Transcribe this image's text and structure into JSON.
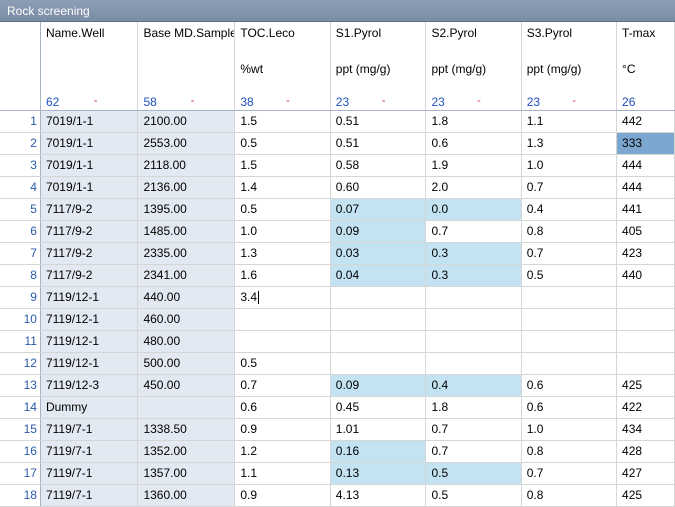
{
  "window": {
    "title": "Rock screening"
  },
  "columns": [
    {
      "name": "Name.Well",
      "unit": "",
      "count": "62",
      "minus": "-"
    },
    {
      "name": "Base MD.Sample",
      "unit": "",
      "count": "58",
      "minus": "-"
    },
    {
      "name": "TOC.Leco",
      "unit": "%wt",
      "count": "38",
      "minus": "-"
    },
    {
      "name": "S1.Pyrol",
      "unit": "ppt (mg/g)",
      "count": "23",
      "minus": "-"
    },
    {
      "name": "S2.Pyrol",
      "unit": "ppt (mg/g)",
      "count": "23",
      "minus": "-"
    },
    {
      "name": "S3.Pyrol",
      "unit": "ppt (mg/g)",
      "count": "23",
      "minus": "-"
    },
    {
      "name": "T-max",
      "unit": "°C",
      "count": "26",
      "minus": ""
    }
  ],
  "rows": [
    {
      "n": "1",
      "cells": [
        "7019/1-1",
        "2100.00",
        "1.5",
        "0.51",
        "1.8",
        "1.1",
        "442"
      ]
    },
    {
      "n": "2",
      "cells": [
        "7019/1-1",
        "2553.00",
        "0.5",
        "0.51",
        "0.6",
        "1.3",
        "333"
      ]
    },
    {
      "n": "3",
      "cells": [
        "7019/1-1",
        "2118.00",
        "1.5",
        "0.58",
        "1.9",
        "1.0",
        "444"
      ]
    },
    {
      "n": "4",
      "cells": [
        "7019/1-1",
        "2136.00",
        "1.4",
        "0.60",
        "2.0",
        "0.7",
        "444"
      ]
    },
    {
      "n": "5",
      "cells": [
        "7117/9-2",
        "1395.00",
        "0.5",
        "0.07",
        "0.0",
        "0.4",
        "441"
      ]
    },
    {
      "n": "6",
      "cells": [
        "7117/9-2",
        "1485.00",
        "1.0",
        "0.09",
        "0.7",
        "0.8",
        "405"
      ]
    },
    {
      "n": "7",
      "cells": [
        "7117/9-2",
        "2335.00",
        "1.3",
        "0.03",
        "0.3",
        "0.7",
        "423"
      ]
    },
    {
      "n": "8",
      "cells": [
        "7117/9-2",
        "2341.00",
        "1.6",
        "0.04",
        "0.3",
        "0.5",
        "440"
      ]
    },
    {
      "n": "9",
      "cells": [
        "7119/12-1",
        "440.00",
        "3.4",
        "",
        "",
        "",
        ""
      ]
    },
    {
      "n": "10",
      "cells": [
        "7119/12-1",
        "460.00",
        "",
        "",
        "",
        "",
        ""
      ]
    },
    {
      "n": "11",
      "cells": [
        "7119/12-1",
        "480.00",
        "",
        "",
        "",
        "",
        ""
      ]
    },
    {
      "n": "12",
      "cells": [
        "7119/12-1",
        "500.00",
        "0.5",
        "",
        "",
        "",
        ""
      ]
    },
    {
      "n": "13",
      "cells": [
        "7119/12-3",
        "450.00",
        "0.7",
        "0.09",
        "0.4",
        "0.6",
        "425"
      ]
    },
    {
      "n": "14",
      "cells": [
        "Dummy",
        "",
        "0.6",
        "0.45",
        "1.8",
        "0.6",
        "422"
      ]
    },
    {
      "n": "15",
      "cells": [
        "7119/7-1",
        "1338.50",
        "0.9",
        "1.01",
        "0.7",
        "1.0",
        "434"
      ]
    },
    {
      "n": "16",
      "cells": [
        "7119/7-1",
        "1352.00",
        "1.2",
        "0.16",
        "0.7",
        "0.8",
        "428"
      ]
    },
    {
      "n": "17",
      "cells": [
        "7119/7-1",
        "1357.00",
        "1.1",
        "0.13",
        "0.5",
        "0.7",
        "427"
      ]
    },
    {
      "n": "18",
      "cells": [
        "7119/7-1",
        "1360.00",
        "0.9",
        "4.13",
        "0.5",
        "0.8",
        "425"
      ]
    }
  ],
  "colors": {
    "title_bg": "#7b8da6",
    "key_col": "#e3e9f2",
    "highlight": "#c3e3f2",
    "selected": "#7aa6cf"
  }
}
